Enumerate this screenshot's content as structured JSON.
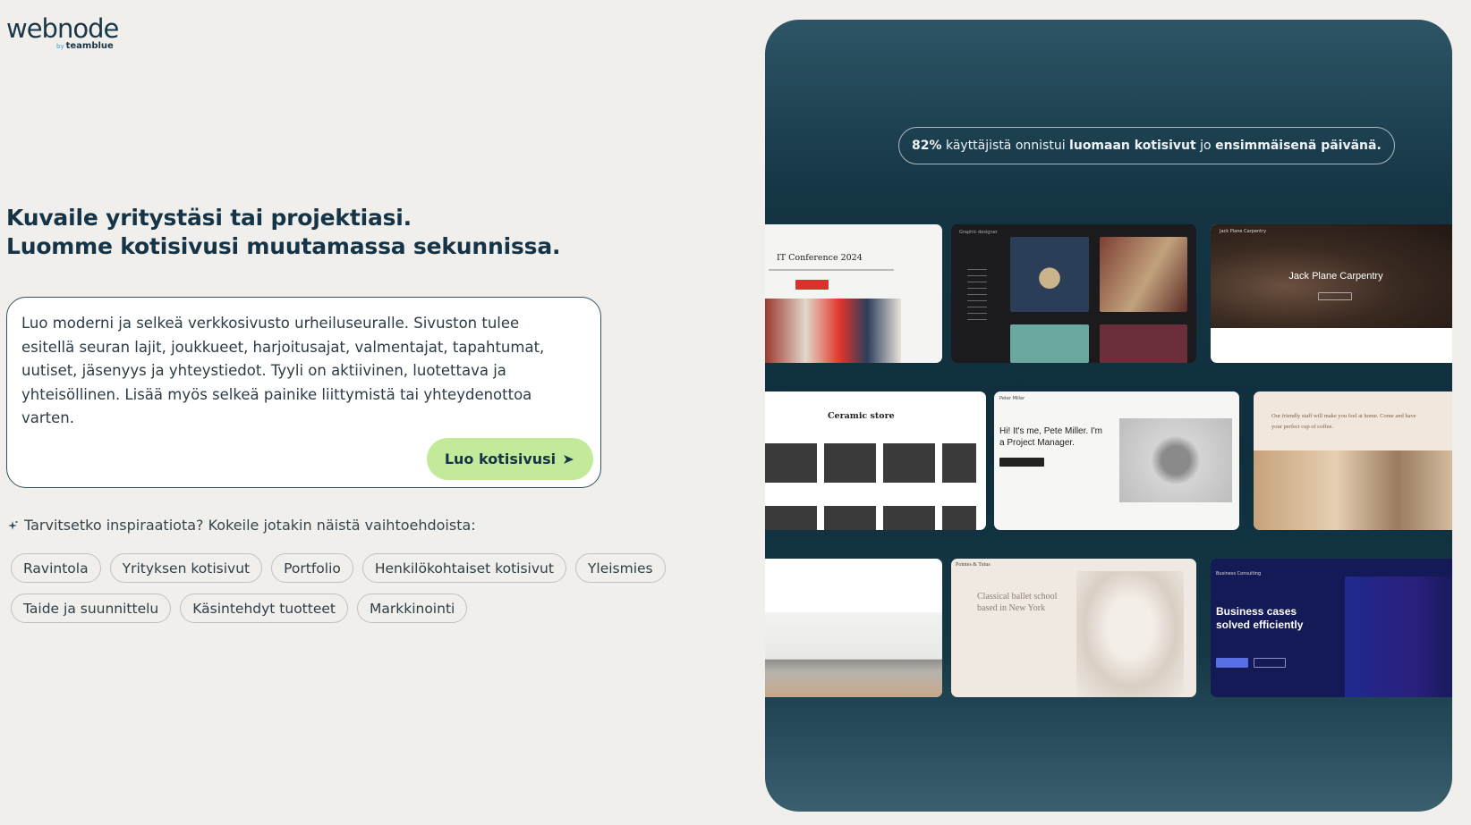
{
  "logo": {
    "name": "webnode",
    "by": "by",
    "brand": "teamblue"
  },
  "headline": {
    "line1": "Kuvaile yritystäsi tai projektiasi.",
    "line2": "Luomme kotisivusi muutamassa sekunnissa."
  },
  "prompt": {
    "value": "Luo moderni ja selkeä verkkosivusto urheiluseuralle. Sivuston tulee esitellä seuran lajit, joukkueet, harjoitusajat, valmentajat, tapahtumat, uutiset, jäsenyys ja yhteystiedot. Tyyli on aktiivinen, luotettava ja yhteisöllinen. Lisää myös selkeä painike liittymistä tai yhteydenottoa varten.",
    "button_label": "Luo kotisivusi",
    "button_icon": "arrow-right-icon"
  },
  "inspiration": {
    "icon": "sparkle-icon",
    "text": "Tarvitsetko inspiraatiota? Kokeile jotakin näistä vaihtoehdoista:",
    "chips": [
      "Ravintola",
      "Yrityksen kotisivut",
      "Portfolio",
      "Henkilökohtaiset kotisivut",
      "Yleismies",
      "Taide ja suunnittelu",
      "Käsintehdyt tuotteet",
      "Markkinointi"
    ]
  },
  "stat": {
    "percent": "82%",
    "part1": " käyttäjistä onnistui ",
    "bold": "luomaan kotisivut",
    "part2": " jo ",
    "bold2": "ensimmäisenä päivänä."
  },
  "templates": {
    "conference_title": "IT Conference 2024",
    "designer_label": "Graphic designer",
    "carpentry_brand": "Jack Plane Carpentry",
    "carpentry_title": "Jack Plane Carpentry",
    "ceramic_title": "Ceramic store",
    "portfolio_name": "Peter Miller",
    "portfolio_intro": "Hi! It's me, Pete Miller. I'm a Project Manager.",
    "cafe_text": "Our friendly staff will make you feel at home. Come and have your perfect cup of coffee.",
    "ballet_brand": "Pointes & Tutus",
    "ballet_title": "Classical ballet school based in New York",
    "consulting_brand": "Business Consulting",
    "consulting_title": "Business cases solved efficiently"
  },
  "colors": {
    "background": "#f0efec",
    "heading": "#153447",
    "button": "#c3ea9b",
    "panel": "#143544"
  }
}
